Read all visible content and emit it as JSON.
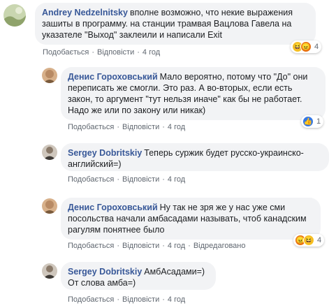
{
  "comments": [
    {
      "author": "Andrey Nedzelnitsky",
      "text_lines": [
        "вполне возможно, что некие выражения",
        "зашиты в программу. на станции трамвая Вацлова Гавела на",
        "указателе \"Выход\" заклеили и написали Exit"
      ],
      "like_label": "Подобається",
      "reply_label": "Відповісти",
      "time": "4 год",
      "reactions": [
        "haha",
        "angry"
      ],
      "reaction_count": "4",
      "avatar_colors": [
        "#8fa36b",
        "#c9d6b0"
      ]
    },
    {
      "author": "Денис Гороховський",
      "text_lines": [
        "Мало вероятно, потому что \"До\" они",
        "переписать же смогли. Это раз. А во-вторых, если есть",
        "закон, то аргумент \"тут нельзя иначе\" как бы не работает.",
        "Надо же или по закону или никак)"
      ],
      "like_label": "Подобається",
      "reply_label": "Відповісти",
      "time": "4 год",
      "reactions": [
        "like"
      ],
      "reaction_count": "1",
      "avatar_colors": [
        "#7a5a3c",
        "#d7b08a"
      ]
    },
    {
      "author": "Sergey Dobritskiy",
      "text_lines": [
        "Теперь суржик будет русско-украинско-",
        "английский=)"
      ],
      "like_label": "Подобається",
      "reply_label": "Відповісти",
      "time": "4 год",
      "reactions": [],
      "reaction_count": "",
      "avatar_colors": [
        "#3e3a36",
        "#cfc7bd"
      ]
    },
    {
      "author": "Денис Гороховський",
      "text_lines": [
        "Ну так не зря же у нас уже сми",
        "посольства начали амбасадами называть, чтоб канадским",
        "рагулям понятнее было"
      ],
      "like_label": "Подобається",
      "reply_label": "Відповісти",
      "time": "4 год",
      "edited_label": "Відредаговано",
      "reactions": [
        "angry",
        "haha"
      ],
      "reaction_count": "4",
      "avatar_colors": [
        "#7a5a3c",
        "#d7b08a"
      ]
    },
    {
      "author": "Sergey Dobritskiy",
      "text_lines": [
        "АмбАсадами=)",
        "От слова амба=)"
      ],
      "like_label": "Подобається",
      "reply_label": "Відповісти",
      "time": "4 год",
      "reactions": [],
      "reaction_count": "",
      "avatar_colors": [
        "#3e3a36",
        "#cfc7bd"
      ]
    }
  ],
  "separator": "·",
  "reaction_icons": {
    "haha": "haha-reaction-icon",
    "like": "like-reaction-icon",
    "angry": "angry-reaction-icon"
  },
  "colors": {
    "author": "#385898",
    "bubble": "#f2f3f5",
    "meta": "#606770"
  }
}
